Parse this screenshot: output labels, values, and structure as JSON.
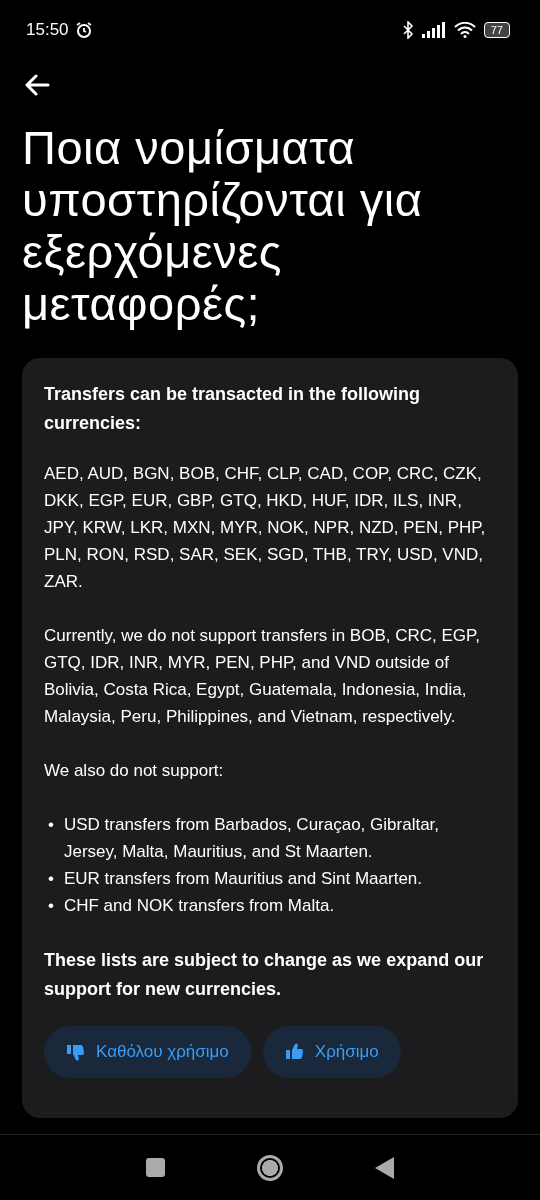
{
  "status_bar": {
    "time": "15:50",
    "battery": "77"
  },
  "title": "Ποια νομίσματα υποστηρίζονται για εξερχόμενες μεταφορές;",
  "article": {
    "heading": "Transfers can be transacted in the following currencies:",
    "paragraphs": [
      "AED, AUD, BGN, BOB, CHF, CLP, CAD, COP, CRC, CZK, DKK, EGP, EUR, GBP, GTQ, HKD, HUF, IDR, ILS, INR, JPY, KRW, LKR, MXN, MYR, NOK, NPR, NZD, PEN, PHP, PLN, RON, RSD, SAR, SEK, SGD, THB, TRY, USD, VND, ZAR.",
      "Currently, we do not support transfers in BOB, CRC, EGP, GTQ, IDR, INR, MYR, PEN, PHP, and VND outside of Bolivia, Costa Rica, Egypt, Guatemala, Indonesia, India, Malaysia, Peru, Philippines, and Vietnam, respectively.",
      "We also do not support:"
    ],
    "bullets": [
      {
        "marker": "•",
        "text": "USD transfers from Barbados, Curaçao, Gibraltar, Jersey, Malta, Mauritius, and St Maarten."
      },
      {
        "marker": "•",
        "text": "EUR transfers from Mauritius and Sint Maarten."
      },
      {
        "marker": "•",
        "text": "CHF and NOK transfers from Malta."
      }
    ],
    "closing": "These lists are subject to change as we expand our support for new currencies."
  },
  "feedback": [
    {
      "kind": "down",
      "label": "Καθόλου χρήσιμο"
    },
    {
      "kind": "up",
      "label": "Χρήσιμο"
    }
  ]
}
